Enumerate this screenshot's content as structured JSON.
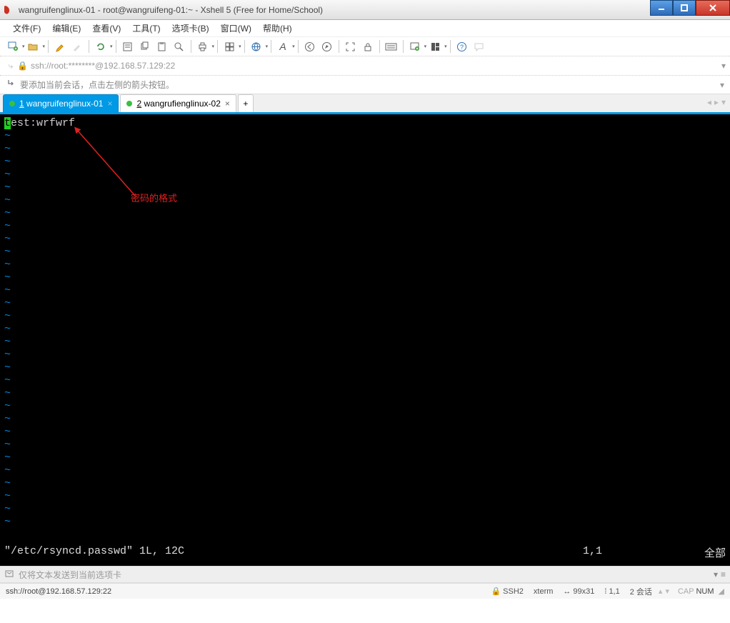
{
  "window": {
    "title": "wangruifenglinux-01 - root@wangruifeng-01:~ - Xshell 5 (Free for Home/School)"
  },
  "menu": {
    "file": "文件(F)",
    "edit": "编辑(E)",
    "view": "查看(V)",
    "tools": "工具(T)",
    "tabs": "选项卡(B)",
    "window": "窗口(W)",
    "help": "帮助(H)"
  },
  "address": {
    "text": "ssh://root:********@192.168.57.129:22"
  },
  "hint": {
    "text": "要添加当前会话，点击左侧的箭头按钮。"
  },
  "tabs": {
    "t1_num": "1",
    "t1_label": " wangruifenglinux-01",
    "t2_num": "2",
    "t2_label": " wangrufienglinux-02",
    "add": "+"
  },
  "terminal": {
    "first_char": "t",
    "rest_line": "est:wrfwrf",
    "tilde": "~",
    "status_file": "\"/etc/rsyncd.passwd\" 1L, 12C",
    "status_pos": "1,1",
    "status_all": "全部"
  },
  "annotation": {
    "text": "密码的格式"
  },
  "sendbar": {
    "text": "仅将文本发送到当前选项卡"
  },
  "status": {
    "left": "ssh://root@192.168.57.129:22",
    "ssh": "SSH2",
    "term": "xterm",
    "size": "99x31",
    "pos": "1,1",
    "sessions": "2 会话",
    "cap": "CAP",
    "num": "NUM"
  }
}
